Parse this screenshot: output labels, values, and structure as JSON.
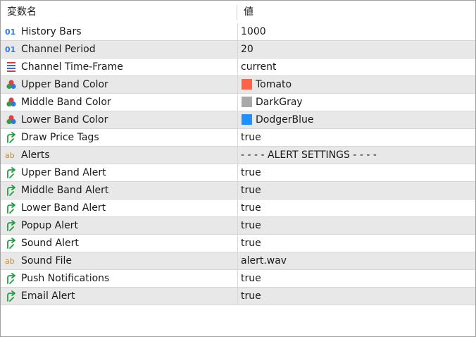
{
  "header": {
    "name_label": "変数名",
    "value_label": "値"
  },
  "rows": [
    {
      "label": "History Bars",
      "value": "1000",
      "icon": "int-icon"
    },
    {
      "label": "Channel Period",
      "value": "20",
      "icon": "int-icon"
    },
    {
      "label": "Channel Time-Frame",
      "value": "current",
      "icon": "enum-icon"
    },
    {
      "label": "Upper Band Color",
      "value": "Tomato",
      "icon": "color-icon",
      "swatch": "#ff6347"
    },
    {
      "label": "Middle Band Color",
      "value": "DarkGray",
      "icon": "color-icon",
      "swatch": "#a9a9a9"
    },
    {
      "label": "Lower Band Color",
      "value": "DodgerBlue",
      "icon": "color-icon",
      "swatch": "#1e90ff"
    },
    {
      "label": "Draw Price Tags",
      "value": "true",
      "icon": "bool-icon"
    },
    {
      "label": "Alerts",
      "value": "- - - - ALERT SETTINGS - - - -",
      "icon": "string-icon"
    },
    {
      "label": "Upper Band Alert",
      "value": "true",
      "icon": "bool-icon"
    },
    {
      "label": "Middle Band Alert",
      "value": "true",
      "icon": "bool-icon"
    },
    {
      "label": "Lower Band Alert",
      "value": "true",
      "icon": "bool-icon"
    },
    {
      "label": "Popup Alert",
      "value": "true",
      "icon": "bool-icon"
    },
    {
      "label": "Sound Alert",
      "value": "true",
      "icon": "bool-icon"
    },
    {
      "label": "Sound File",
      "value": "alert.wav",
      "icon": "string-icon"
    },
    {
      "label": "Push Notifications",
      "value": "true",
      "icon": "bool-icon"
    },
    {
      "label": "Email Alert",
      "value": "true",
      "icon": "bool-icon"
    }
  ]
}
